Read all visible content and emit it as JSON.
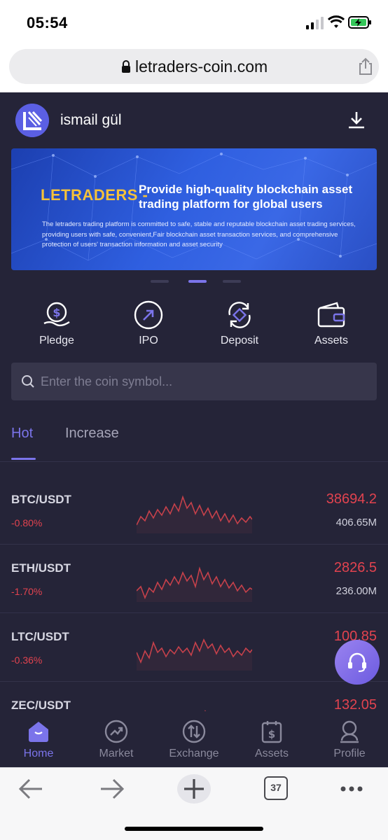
{
  "status_bar": {
    "time": "05:54"
  },
  "browser": {
    "url": "letraders-coin.com",
    "tabs_count": "37"
  },
  "header": {
    "username": "ismail gül"
  },
  "banner": {
    "brand": "LETRADERS -",
    "tagline": "Provide high-quality blockchain asset trading platform for global users",
    "description": "The letraders trading platform is committed to safe, stable and reputable blockchain asset trading services, providing users with safe, convenient,Fair blockchain asset transaction services, and comprehensive protection of users' transaction information and asset security",
    "slides": 3,
    "active_slide": 2
  },
  "quick_actions": [
    {
      "label": "Pledge",
      "icon": "pledge-dollar-hand-icon"
    },
    {
      "label": "IPO",
      "icon": "ipo-arrow-circle-icon"
    },
    {
      "label": "Deposit",
      "icon": "deposit-refresh-icon"
    },
    {
      "label": "Assets",
      "icon": "wallet-icon"
    }
  ],
  "search": {
    "placeholder": "Enter the coin symbol..."
  },
  "tabs": [
    {
      "label": "Hot",
      "active": true
    },
    {
      "label": "Increase",
      "active": false
    }
  ],
  "market": [
    {
      "pair": "BTC/USDT",
      "change": "-0.80%",
      "price": "38694.2",
      "volume": "406.65M"
    },
    {
      "pair": "ETH/USDT",
      "change": "-1.70%",
      "price": "2826.5",
      "volume": "236.00M"
    },
    {
      "pair": "LTC/USDT",
      "change": "-0.36%",
      "price": "100.85",
      "volume": ""
    },
    {
      "pair": "ZEC/USDT",
      "change": "",
      "price": "132.05",
      "volume": ""
    }
  ],
  "bottom_nav": [
    {
      "label": "Home",
      "icon": "home-icon",
      "active": true
    },
    {
      "label": "Market",
      "icon": "market-trend-icon",
      "active": false
    },
    {
      "label": "Exchange",
      "icon": "exchange-icon",
      "active": false
    },
    {
      "label": "Assets",
      "icon": "assets-clipboard-icon",
      "active": false
    },
    {
      "label": "Profile",
      "icon": "profile-icon",
      "active": false
    }
  ],
  "colors": {
    "background": "#252438",
    "accent": "#7b74ea",
    "negative": "#e2434f",
    "brand_gold": "#f5c23a"
  }
}
